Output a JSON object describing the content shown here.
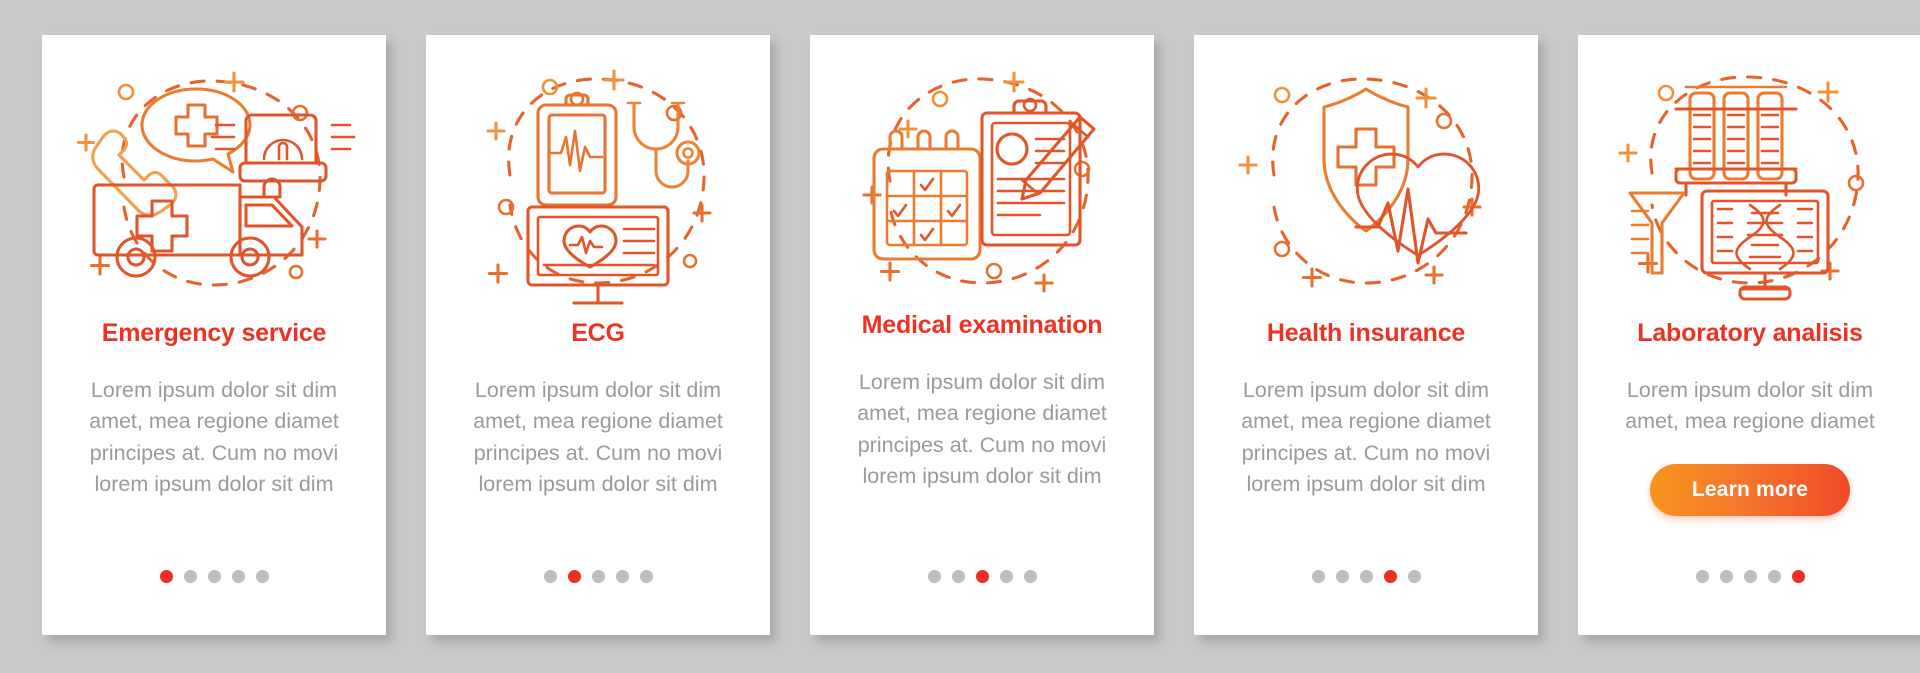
{
  "background_color": "#c9c9c9",
  "card_background": "#ffffff",
  "colors": {
    "title": "#ed3224",
    "body_text": "#9a9a9a",
    "dot_active": "#ef2e22",
    "dot_inactive": "#bdbdbd",
    "icon_orange": "#f08a3c",
    "icon_red_orange": "#e0562a",
    "button_gradient_from": "#f7941e",
    "button_gradient_to": "#f04a2a"
  },
  "cards": [
    {
      "id": "emergency-service",
      "icon_name": "ambulance-emergency-call-icon",
      "title": "Emergency service",
      "body": "Lorem ipsum dolor sit dim amet, mea regione diamet principes at. Cum no movi lorem ipsum dolor sit dim",
      "dots": {
        "count": 5,
        "active_index": 0
      },
      "has_button": false,
      "button_label": ""
    },
    {
      "id": "ecg",
      "icon_name": "ecg-monitor-clipboard-stethoscope-icon",
      "title": "ECG",
      "body": "Lorem ipsum dolor sit dim amet, mea regione diamet principes at. Cum no movi lorem ipsum dolor sit dim",
      "dots": {
        "count": 5,
        "active_index": 1
      },
      "has_button": false,
      "button_label": ""
    },
    {
      "id": "medical-examination",
      "icon_name": "calendar-clipboard-pen-icon",
      "title": "Medical examination",
      "body": "Lorem ipsum dolor sit dim amet, mea regione diamet principes at. Cum no movi lorem ipsum dolor sit dim",
      "dots": {
        "count": 5,
        "active_index": 2
      },
      "has_button": false,
      "button_label": ""
    },
    {
      "id": "health-insurance",
      "icon_name": "shield-cross-heartbeat-icon",
      "title": "Health insurance",
      "body": "Lorem ipsum dolor sit dim amet, mea regione diamet principes at. Cum no movi lorem ipsum dolor sit dim",
      "dots": {
        "count": 5,
        "active_index": 3
      },
      "has_button": false,
      "button_label": ""
    },
    {
      "id": "laboratory-analisis",
      "icon_name": "test-tubes-dna-screen-flask-icon",
      "title": "Laboratory analisis",
      "body": "Lorem ipsum dolor sit dim amet, mea regione diamet",
      "dots": {
        "count": 5,
        "active_index": 4
      },
      "has_button": true,
      "button_label": "Learn more"
    }
  ]
}
